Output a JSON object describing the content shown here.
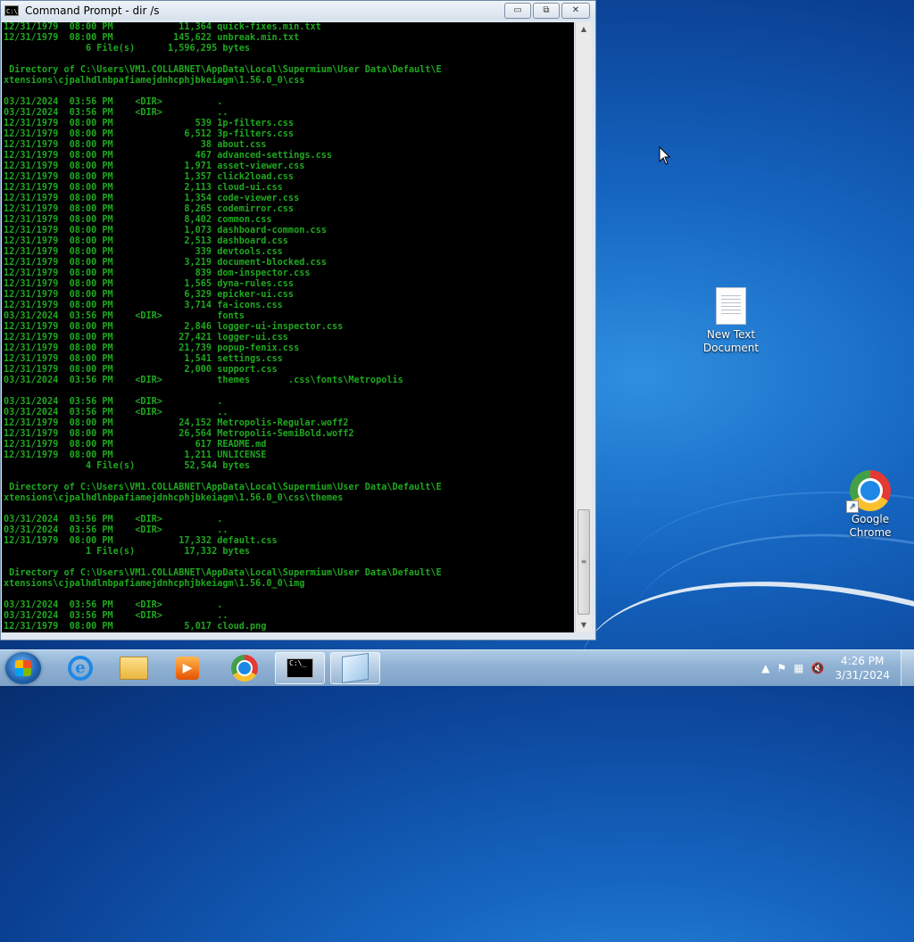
{
  "cmd": {
    "title": "Command Prompt - dir /s",
    "title_icon": "C:\\",
    "minimize": "▭",
    "maximize": "⧉",
    "close": "✕",
    "output": "12/31/1979  08:00 PM            11,364 quick-fixes.min.txt\n12/31/1979  08:00 PM           145,622 unbreak.min.txt\n               6 File(s)      1,596,295 bytes\n\n Directory of C:\\Users\\VM1.COLLABNET\\AppData\\Local\\Supermium\\User Data\\Default\\E\nxtensions\\cjpalhdlnbpafiamejdnhcphjbkeiagm\\1.56.0_0\\css\n\n03/31/2024  03:56 PM    <DIR>          .\n03/31/2024  03:56 PM    <DIR>          ..\n12/31/1979  08:00 PM               539 1p-filters.css\n12/31/1979  08:00 PM             6,512 3p-filters.css\n12/31/1979  08:00 PM                38 about.css\n12/31/1979  08:00 PM               467 advanced-settings.css\n12/31/1979  08:00 PM             1,971 asset-viewer.css\n12/31/1979  08:00 PM             1,357 click2load.css\n12/31/1979  08:00 PM             2,113 cloud-ui.css\n12/31/1979  08:00 PM             1,354 code-viewer.css\n12/31/1979  08:00 PM             8,265 codemirror.css\n12/31/1979  08:00 PM             8,402 common.css\n12/31/1979  08:00 PM             1,073 dashboard-common.css\n12/31/1979  08:00 PM             2,513 dashboard.css\n12/31/1979  08:00 PM               339 devtools.css\n12/31/1979  08:00 PM             3,219 document-blocked.css\n12/31/1979  08:00 PM               839 dom-inspector.css\n12/31/1979  08:00 PM             1,565 dyna-rules.css\n12/31/1979  08:00 PM             6,329 epicker-ui.css\n12/31/1979  08:00 PM             3,714 fa-icons.css\n03/31/2024  03:56 PM    <DIR>          fonts\n12/31/1979  08:00 PM             2,846 logger-ui-inspector.css\n12/31/1979  08:00 PM            27,421 logger-ui.css\n12/31/1979  08:00 PM            21,739 popup-fenix.css\n12/31/1979  08:00 PM             1,541 settings.css\n12/31/1979  08:00 PM             2,000 support.css\n03/31/2024  03:56 PM    <DIR>          themes       .css\\fonts\\Metropolis\n\n03/31/2024  03:56 PM    <DIR>          .\n03/31/2024  03:56 PM    <DIR>          ..\n12/31/1979  08:00 PM            24,152 Metropolis-Regular.woff2\n12/31/1979  08:00 PM            26,564 Metropolis-SemiBold.woff2\n12/31/1979  08:00 PM               617 README.md\n12/31/1979  08:00 PM             1,211 UNLICENSE\n               4 File(s)         52,544 bytes\n\n Directory of C:\\Users\\VM1.COLLABNET\\AppData\\Local\\Supermium\\User Data\\Default\\E\nxtensions\\cjpalhdlnbpafiamejdnhcphjbkeiagm\\1.56.0_0\\css\\themes\n\n03/31/2024  03:56 PM    <DIR>          .\n03/31/2024  03:56 PM    <DIR>          ..\n12/31/1979  08:00 PM            17,332 default.css\n               1 File(s)         17,332 bytes\n\n Directory of C:\\Users\\VM1.COLLABNET\\AppData\\Local\\Supermium\\User Data\\Default\\E\nxtensions\\cjpalhdlnbpafiamejdnhcphjbkeiagm\\1.56.0_0\\img\n\n03/31/2024  03:56 PM    <DIR>          .\n03/31/2024  03:56 PM    <DIR>          ..\n12/31/1979  08:00 PM             5,017 cloud.png"
  },
  "desktop": {
    "icons": [
      {
        "label": "New Text Document",
        "icon": "text-document-icon"
      },
      {
        "label": "Google Chrome",
        "icon": "chrome-icon"
      }
    ]
  },
  "taskbar": {
    "media_glyph": "▶",
    "cmd_glyph": "C:\\_",
    "tray": {
      "show_hidden": "▲",
      "flag": "⚑",
      "network": "▦",
      "volume": "🔇"
    },
    "time": "4:26 PM",
    "date": "3/31/2024"
  },
  "colors": {
    "console_text": "#1fa81f",
    "console_bg": "#000000",
    "desktop_bg": "#1565c0"
  }
}
